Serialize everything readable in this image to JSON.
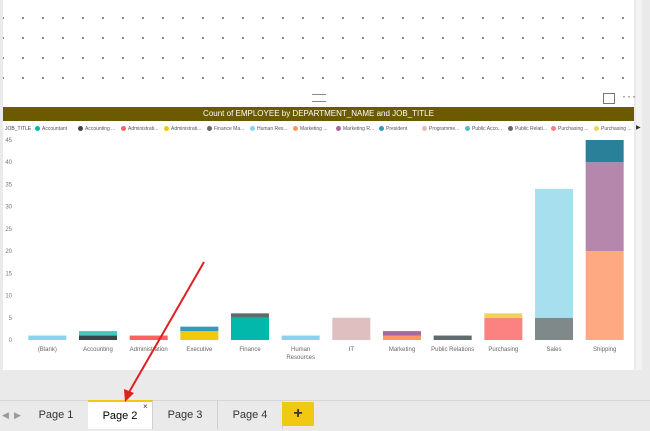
{
  "visual": {
    "title": "Count of EMPLOYEE by DEPARTMENT_NAME and JOB_TITLE",
    "legend_heading": "JOB_TITLE",
    "legend": [
      {
        "label": "Accountant",
        "color": "#01B8AA"
      },
      {
        "label": "Accounting ...",
        "color": "#374649"
      },
      {
        "label": "Administrati...",
        "color": "#FD625E"
      },
      {
        "label": "Administrati...",
        "color": "#F2C80F"
      },
      {
        "label": "Finance Ma...",
        "color": "#5F6B6D"
      },
      {
        "label": "Human Res...",
        "color": "#8AD4EB"
      },
      {
        "label": "Marketing ...",
        "color": "#FE9666"
      },
      {
        "label": "Marketing R...",
        "color": "#A66999"
      },
      {
        "label": "President",
        "color": "#3599B8"
      },
      {
        "label": "Programme...",
        "color": "#DFBFBF"
      },
      {
        "label": "Public Acco...",
        "color": "#4AC5BB"
      },
      {
        "label": "Public Relati...",
        "color": "#5F6B6D"
      },
      {
        "label": "Purchasing ...",
        "color": "#FB8281"
      },
      {
        "label": "Purchasing ...",
        "color": "#F4D25A"
      }
    ]
  },
  "chart_data": {
    "type": "bar",
    "stacked": true,
    "title": "Count of EMPLOYEE by DEPARTMENT_NAME and JOB_TITLE",
    "xlabel": "",
    "ylabel": "",
    "ylim": [
      0,
      45
    ],
    "yticks": [
      0,
      5,
      10,
      15,
      20,
      25,
      30,
      35,
      40,
      45
    ],
    "categories": [
      "(Blank)",
      "Accounting",
      "Administration",
      "Executive",
      "Finance",
      "Human Resources",
      "IT",
      "Marketing",
      "Public Relations",
      "Purchasing",
      "Sales",
      "Shipping"
    ],
    "category_labels": [
      "(Blank)",
      "Accounting",
      "Administration",
      "Executive",
      "Finance",
      "Human\nResources",
      "IT",
      "Marketing",
      "Public Relations",
      "Purchasing",
      "Sales",
      "Shipping"
    ],
    "stacks": [
      [
        {
          "value": 1,
          "color": "#8AD4EB"
        }
      ],
      [
        {
          "value": 1,
          "color": "#374649"
        },
        {
          "value": 1,
          "color": "#4AC5BB"
        }
      ],
      [
        {
          "value": 1,
          "color": "#FD625E"
        }
      ],
      [
        {
          "value": 2,
          "color": "#F2C80F"
        },
        {
          "value": 1,
          "color": "#3599B8"
        }
      ],
      [
        {
          "value": 5,
          "color": "#01B8AA"
        },
        {
          "value": 1,
          "color": "#5F6B6D"
        }
      ],
      [
        {
          "value": 1,
          "color": "#8AD4EB"
        }
      ],
      [
        {
          "value": 5,
          "color": "#DFBFBF"
        }
      ],
      [
        {
          "value": 1,
          "color": "#FE9666"
        },
        {
          "value": 1,
          "color": "#A66999"
        }
      ],
      [
        {
          "value": 1,
          "color": "#5F6B6D"
        }
      ],
      [
        {
          "value": 5,
          "color": "#FB8281"
        },
        {
          "value": 1,
          "color": "#F4D25A"
        }
      ],
      [
        {
          "value": 5,
          "color": "#7F898A"
        },
        {
          "value": 29,
          "color": "#A7DFEF"
        }
      ],
      [
        {
          "value": 20,
          "color": "#FFA983"
        },
        {
          "value": 20,
          "color": "#B687AC"
        },
        {
          "value": 5,
          "color": "#2A7F99"
        }
      ]
    ]
  },
  "tabs": [
    {
      "label": "Page 1",
      "active": false
    },
    {
      "label": "Page 2",
      "active": true
    },
    {
      "label": "Page 3",
      "active": false
    },
    {
      "label": "Page 4",
      "active": false
    }
  ],
  "add_page_label": "+",
  "close_label": "×",
  "nav": {
    "prev": "◀",
    "next": "▶"
  },
  "more_label": "···"
}
